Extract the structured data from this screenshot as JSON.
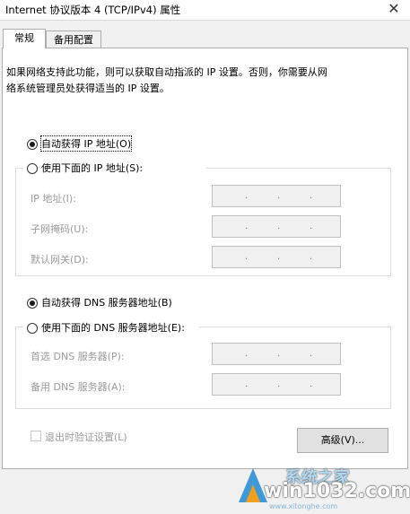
{
  "window": {
    "title": "Internet 协议版本 4 (TCP/IPv4) 属性",
    "close_glyph": "✕"
  },
  "tabs": [
    {
      "label": "常规",
      "active": true
    },
    {
      "label": "备用配置",
      "active": false
    }
  ],
  "general": {
    "description": "如果网络支持此功能，则可以获取自动指派的 IP 设置。否则，你需要从网\n络系统管理员处获得适当的 IP 设置。",
    "ip_auto": {
      "label": "自动获得 IP 地址(O)",
      "checked": true
    },
    "ip_manual": {
      "label": "使用下面的 IP 地址(S):",
      "checked": false
    },
    "ip_fields": [
      {
        "label": "IP 地址(I):",
        "value": ""
      },
      {
        "label": "子网掩码(U):",
        "value": ""
      },
      {
        "label": "默认网关(D):",
        "value": ""
      }
    ],
    "dns_auto": {
      "label": "自动获得 DNS 服务器地址(B)",
      "checked": true
    },
    "dns_manual": {
      "label": "使用下面的 DNS 服务器地址(E):",
      "checked": false
    },
    "dns_fields": [
      {
        "label": "首选 DNS 服务器(P):",
        "value": ""
      },
      {
        "label": "备用 DNS 服务器(A):",
        "value": ""
      }
    ],
    "validate_on_exit": {
      "label": "退出时验证设置(L)",
      "checked": false
    },
    "advanced_button": "高级(V)..."
  },
  "watermark": {
    "text": "win1032.com",
    "sub_text": "系统之家",
    "url_text": "www.xitonghe.com"
  },
  "colors": {
    "dialog_bg": "#f0f0f0",
    "panel_bg": "#ffffff",
    "disabled_text": "#9b9b9b",
    "border": "#adadad"
  }
}
